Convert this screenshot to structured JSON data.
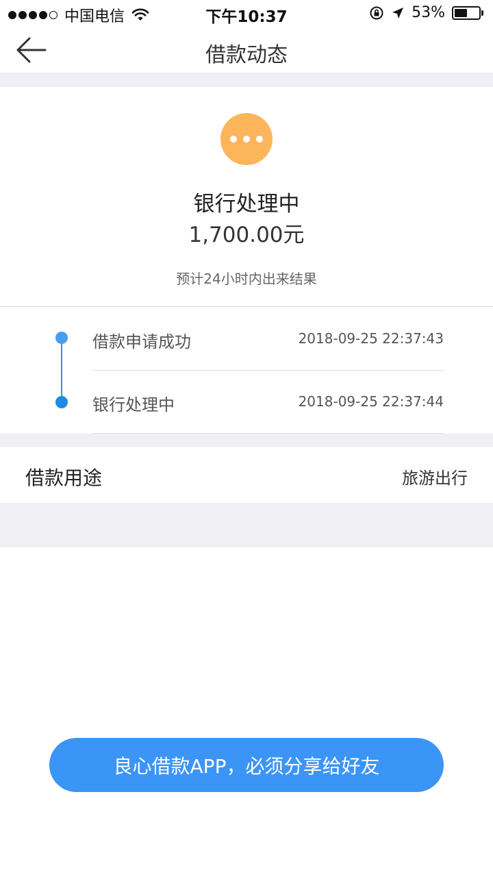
{
  "status_bar": {
    "carrier": "中国电信",
    "time": "下午10:37",
    "battery_percent": "53%",
    "battery_level": 0.53,
    "signal_bars_filled": 4,
    "signal_bars_total": 5,
    "icons": [
      "signal-icon",
      "wifi-icon",
      "rotation-lock-icon",
      "location-arrow-icon",
      "battery-icon"
    ]
  },
  "nav": {
    "title": "借款动态",
    "back_icon": "back-arrow-icon"
  },
  "status_card": {
    "icon": "ellipsis-icon",
    "icon_color": "#fdb55b",
    "title": "银行处理中",
    "amount": "1,700.00元",
    "note": "预计24小时内出来结果"
  },
  "timeline": {
    "line_color": "#3a8fe6",
    "items": [
      {
        "label": "借款申请成功",
        "time": "2018-09-25 22:37:43",
        "dot_color": "#4a9cf0"
      },
      {
        "label": "银行处理中",
        "time": "2018-09-25 22:37:44",
        "dot_color": "#1f88e5"
      }
    ]
  },
  "purpose": {
    "label": "借款用途",
    "value": "旅游出行"
  },
  "share_button": {
    "label": "良心借款APP，必须分享给好友",
    "color": "#3b95f7"
  },
  "colors": {
    "background_strip": "#efeff4"
  }
}
